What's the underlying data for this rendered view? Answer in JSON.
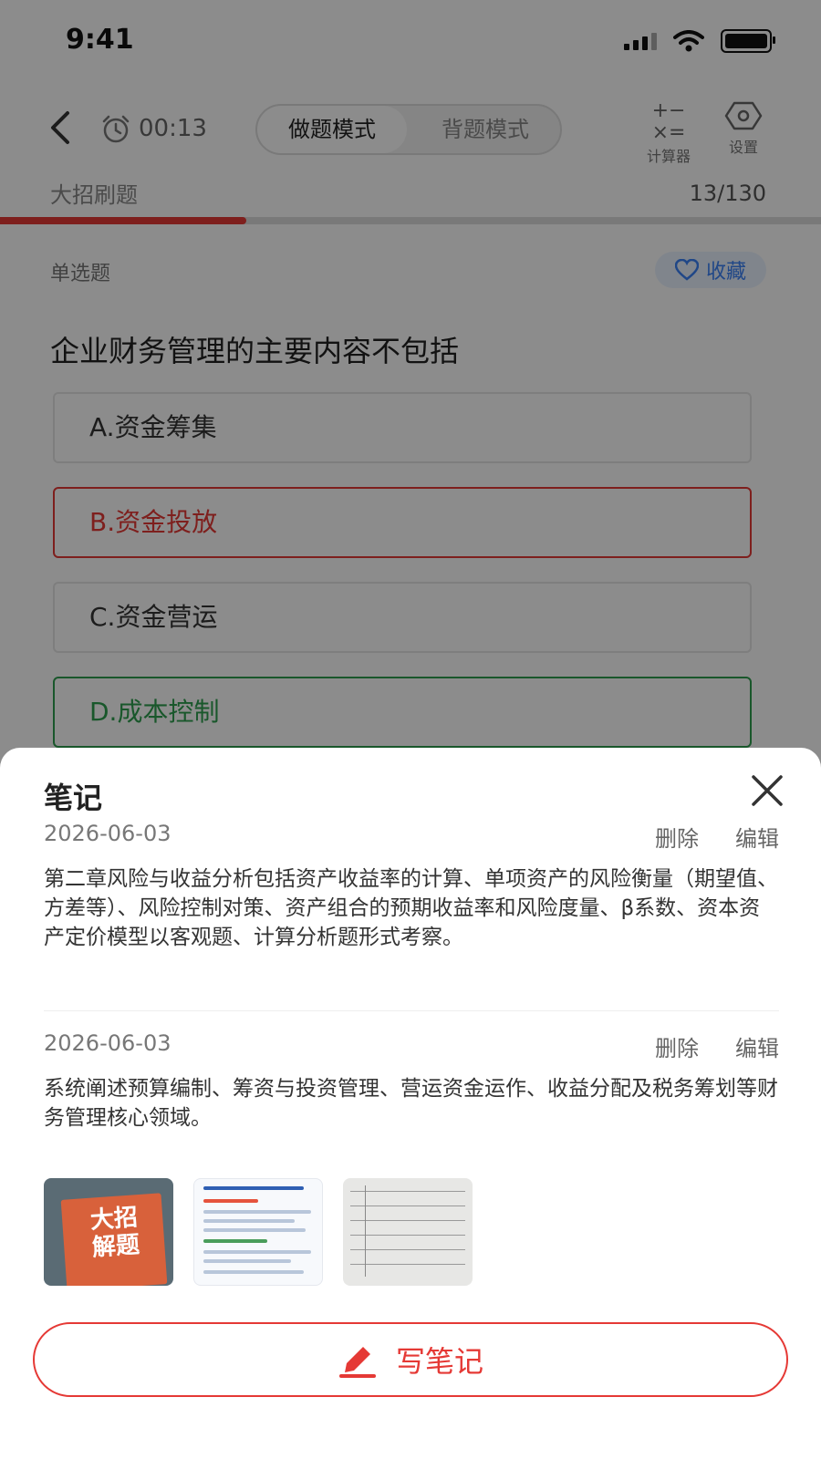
{
  "status_bar": {
    "time": "9:41"
  },
  "nav": {
    "timer": "00:13",
    "mode_active": "做题模式",
    "mode_inactive": "背题模式",
    "calculator_label": "计算器",
    "settings_label": "设置"
  },
  "quiz": {
    "title": "大招刷题",
    "counter": "13/130",
    "progress": 0.3,
    "question_type": "单选题",
    "collect_label": "收藏",
    "question": "企业财务管理的主要内容不包括",
    "options": [
      {
        "label": "A.资金筹集",
        "state": "normal"
      },
      {
        "label": "B.资金投放",
        "state": "wrong"
      },
      {
        "label": "C.资金营运",
        "state": "normal"
      },
      {
        "label": "D.成本控制",
        "state": "correct"
      }
    ]
  },
  "notes_sheet": {
    "title": "笔记",
    "notes": [
      {
        "date": "2026-06-03",
        "delete_label": "删除",
        "edit_label": "编辑",
        "text": "第二章风险与收益分析包括资产收益率的计算、单项资产的风险衡量（期望值、方差等）、风险控制对策、资产组合的预期收益率和风险度量、β系数、资本资产定价模型以客观题、计算分析题形式考察。"
      },
      {
        "date": "2026-06-03",
        "delete_label": "删除",
        "edit_label": "编辑",
        "text": "系统阐述预算编制、筹资与投资管理、营运资金运作、收益分配及税务筹划等财务管理核心领域。"
      }
    ],
    "thumbnail_book_text": "大招解题",
    "write_button_label": "写笔记"
  },
  "colors": {
    "accent": "#e53935",
    "correct": "#2e9e4f",
    "collect": "#3b82f6"
  }
}
